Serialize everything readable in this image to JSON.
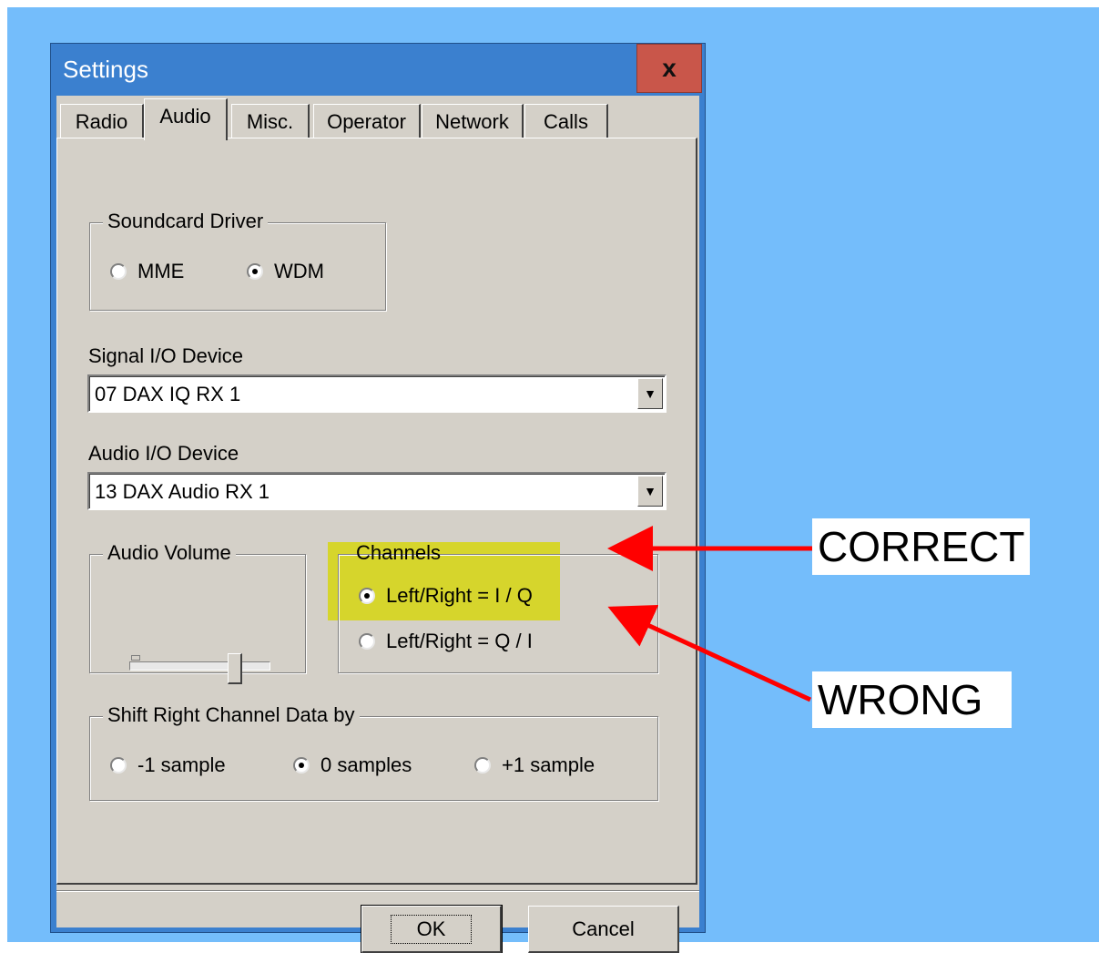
{
  "window": {
    "title": "Settings",
    "close_label": "x"
  },
  "tabs": [
    "Radio",
    "Audio",
    "Misc.",
    "Operator",
    "Network",
    "Calls"
  ],
  "active_tab": "Audio",
  "soundcard": {
    "legend": "Soundcard Driver",
    "options": [
      {
        "label": "MME",
        "selected": false
      },
      {
        "label": "WDM",
        "selected": true
      }
    ]
  },
  "signal_io": {
    "label": "Signal I/O Device",
    "value": "07  DAX IQ RX 1"
  },
  "audio_io": {
    "label": "Audio I/O Device",
    "value": "13  DAX Audio RX 1"
  },
  "volume": {
    "legend": "Audio Volume",
    "level": 0.7
  },
  "channels": {
    "legend": "Channels",
    "options": [
      {
        "label": "Left/Right = I / Q",
        "selected": true
      },
      {
        "label": "Left/Right = Q / I",
        "selected": false
      }
    ]
  },
  "shift": {
    "legend": "Shift Right Channel Data by",
    "options": [
      {
        "label": "-1 sample",
        "selected": false
      },
      {
        "label": "0 samples",
        "selected": true
      },
      {
        "label": "+1 sample",
        "selected": false
      }
    ]
  },
  "buttons": {
    "ok": "OK",
    "cancel": "Cancel"
  },
  "annotations": {
    "correct": "CORRECT",
    "wrong": "WRONG"
  },
  "colors": {
    "background": "#74bdfb",
    "titlebar": "#3b80cf",
    "close": "#c9564a",
    "highlight": "#d6d600",
    "arrow": "#ff0000"
  }
}
